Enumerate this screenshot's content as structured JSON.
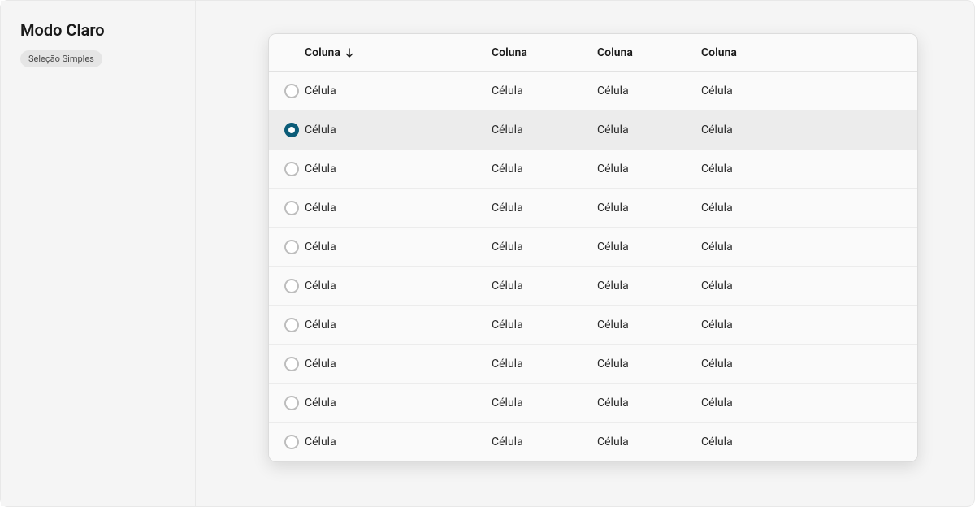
{
  "sidebar": {
    "title": "Modo Claro",
    "chip": "Seleção Simples"
  },
  "table": {
    "headers": [
      "Coluna",
      "Coluna",
      "Coluna",
      "Coluna"
    ],
    "sortedColumn": 0,
    "sortDirection": "asc",
    "rows": [
      {
        "selected": false,
        "cells": [
          "Célula",
          "Célula",
          "Célula",
          "Célula"
        ]
      },
      {
        "selected": true,
        "cells": [
          "Célula",
          "Célula",
          "Célula",
          "Célula"
        ]
      },
      {
        "selected": false,
        "cells": [
          "Célula",
          "Célula",
          "Célula",
          "Célula"
        ]
      },
      {
        "selected": false,
        "cells": [
          "Célula",
          "Célula",
          "Célula",
          "Célula"
        ]
      },
      {
        "selected": false,
        "cells": [
          "Célula",
          "Célula",
          "Célula",
          "Célula"
        ]
      },
      {
        "selected": false,
        "cells": [
          "Célula",
          "Célula",
          "Célula",
          "Célula"
        ]
      },
      {
        "selected": false,
        "cells": [
          "Célula",
          "Célula",
          "Célula",
          "Célula"
        ]
      },
      {
        "selected": false,
        "cells": [
          "Célula",
          "Célula",
          "Célula",
          "Célula"
        ]
      },
      {
        "selected": false,
        "cells": [
          "Célula",
          "Célula",
          "Célula",
          "Célula"
        ]
      },
      {
        "selected": false,
        "cells": [
          "Célula",
          "Célula",
          "Célula",
          "Célula"
        ]
      }
    ]
  },
  "colors": {
    "accent": "#0b5c78"
  }
}
